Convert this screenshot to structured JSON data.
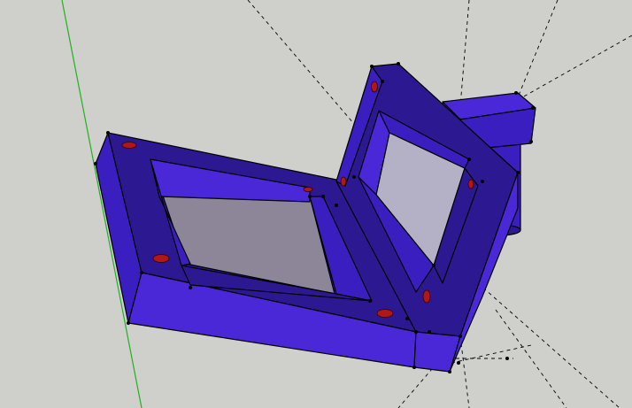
{
  "viewport": {
    "background": "#cfcfcb",
    "axis_color": "#1fb31f",
    "colors": {
      "face_light": "#4a28d8",
      "face_mid": "#3a1ebf",
      "face_dark": "#2c1890",
      "glass": "#8c8698",
      "glass_light": "#b4b0c6",
      "hole": "#b01818"
    }
  },
  "model": {
    "name": "l-shaped-frame",
    "hole_count": 8,
    "components": [
      "left-frame",
      "right-frame",
      "corner-bracket",
      "cylinder-mount"
    ]
  }
}
